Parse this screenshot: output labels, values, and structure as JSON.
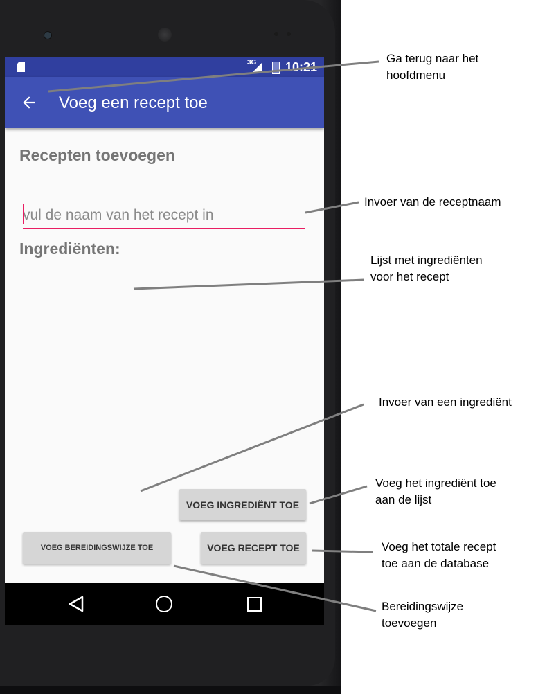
{
  "status_bar": {
    "network": "3G",
    "time": "10:21"
  },
  "app_bar": {
    "back_icon": "arrow-left-icon",
    "title": "Voeg een recept toe"
  },
  "content": {
    "section_title": "Recepten toevoegen",
    "recipe_name_input": {
      "value": "",
      "placeholder": "vul de naam van het recept in"
    },
    "ingredients_title": "Ingrediënten:",
    "ingredient_input": {
      "value": "",
      "placeholder": ""
    },
    "add_ingredient_button": "VOEG INGREDIËNT TOE",
    "add_preparation_button": "VOEG BEREIDINGSWIJZE TOE",
    "add_recipe_button": "VOEG RECEPT TOE"
  },
  "nav_bar": {
    "back": "triangle-back-icon",
    "home": "circle-home-icon",
    "recents": "square-recents-icon"
  },
  "annotations": {
    "back_note": [
      "Ga terug naar het",
      "hoofdmenu"
    ],
    "name_note": [
      "Invoer van de receptnaam"
    ],
    "list_note": [
      "Lijst met ingrediënten",
      "voor het recept"
    ],
    "ingredient_input_note": [
      "Invoer van een ingrediënt"
    ],
    "add_ingredient_note": [
      "Voeg het ingrediënt toe",
      "aan de lijst"
    ],
    "add_recipe_note": [
      "Voeg het totale recept",
      "toe aan de database"
    ],
    "preparation_note": [
      "Bereidingswijze",
      "toevoegen"
    ]
  },
  "colors": {
    "primary": "#3f51b5",
    "primary_dark": "#303f9f",
    "accent": "#e91e63",
    "button": "#d6d6d6",
    "annotation_line": "#7f7f7f"
  }
}
